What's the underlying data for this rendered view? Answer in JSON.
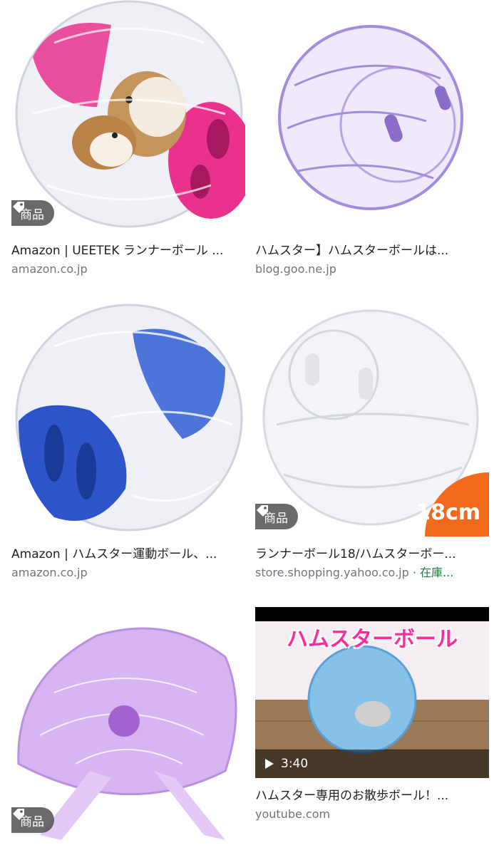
{
  "results": [
    {
      "title": "Amazon | UEETEK ランナーボール ...",
      "source": "amazon.co.jp",
      "badge": "商品",
      "image_desc": "clear hamster ball with pink caps and hamsters"
    },
    {
      "title": "ハムスター】ハムスターボールは...",
      "source": "blog.goo.ne.jp",
      "image_desc": "clear purple hamster ball"
    },
    {
      "title": "Amazon | ハムスター運動ボール、...",
      "source": "amazon.co.jp",
      "image_desc": "clear hamster ball with blue caps"
    },
    {
      "title": "ランナーボール18/ハムスターボー...",
      "source": "store.shopping.yahoo.co.jp",
      "stock": "· 在庫...",
      "badge": "商品",
      "size_label": "18cm",
      "image_desc": "clear hamster ball"
    },
    {
      "title": "",
      "source": "",
      "badge": "商品",
      "image_desc": "purple flying saucer exercise wheel"
    },
    {
      "title": "ハムスター専用のお散歩ボール！...",
      "source": "youtube.com",
      "duration": "3:40",
      "overlay_text": "ハムスターボール",
      "image_desc": "blue hamster ball on wooden floor video thumbnail"
    }
  ],
  "colors": {
    "pink": "#e8328c",
    "blue": "#2d54c8",
    "purple": "#b98fe0",
    "source_grey": "#70757a",
    "stock_green": "#188038"
  }
}
